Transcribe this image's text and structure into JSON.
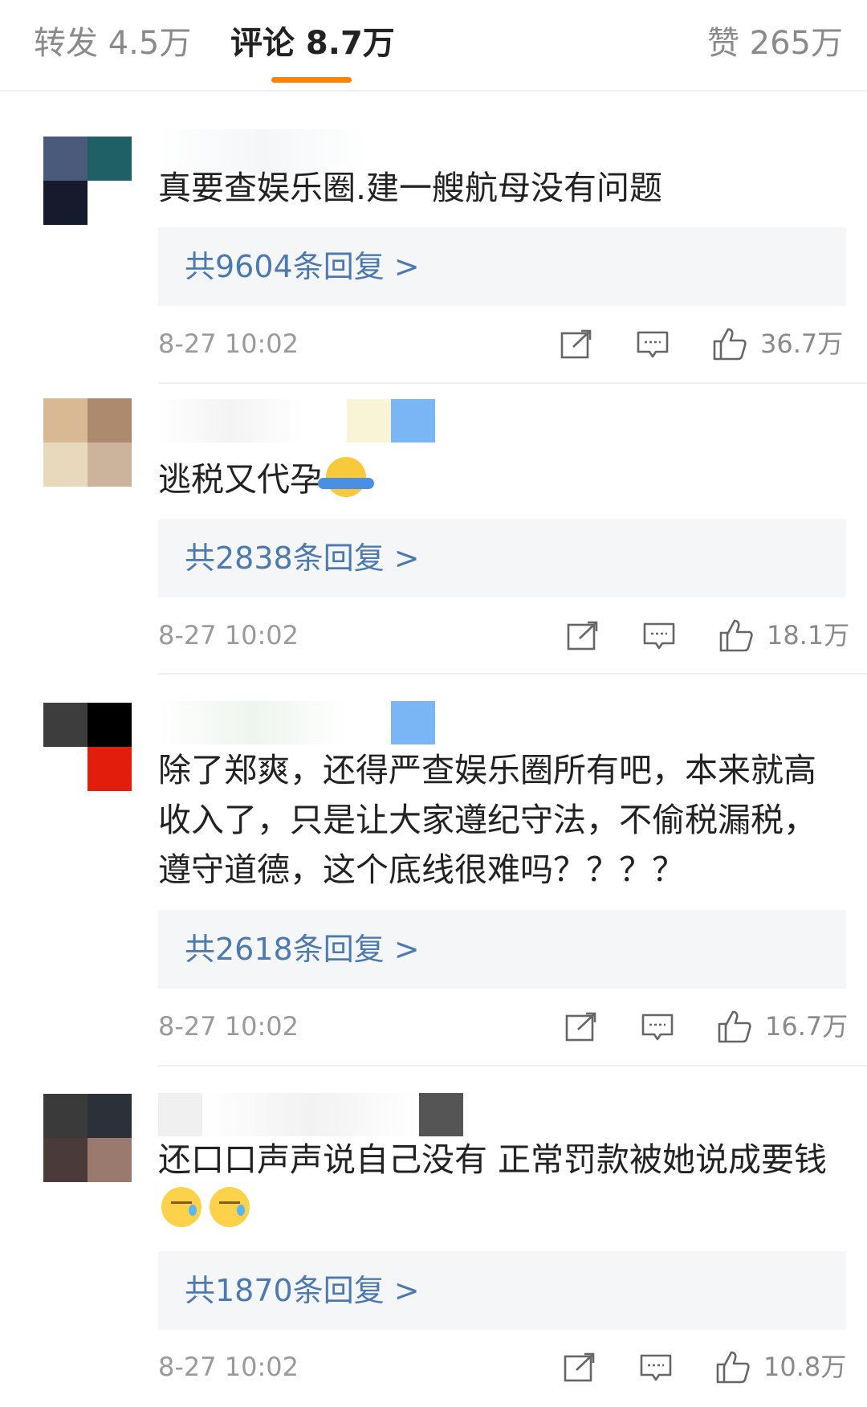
{
  "tabs": {
    "repost": "转发 4.5万",
    "comments": "评论 8.7万",
    "likes": "赞 265万"
  },
  "accent_color": "#ff8200",
  "link_color": "#4c7ab0",
  "comments": [
    {
      "text": "真要查娱乐圈.建一艘航母没有问题",
      "emojis": [],
      "replies": "共9604条回复 >",
      "timestamp": "8-27 10:02",
      "likes": "36.7万"
    },
    {
      "text": "逃税又代孕",
      "emojis": [
        "shrug-emoji"
      ],
      "replies": "共2838条回复 >",
      "timestamp": "8-27 10:02",
      "likes": "18.1万"
    },
    {
      "text": "除了郑爽，还得严查娱乐圈所有吧，本来就高收入了，只是让大家遵纪守法，不偷税漏税，遵守道德，这个底线很难吗？？？？",
      "emojis": [],
      "replies": "共2618条回复 >",
      "timestamp": "8-27 10:02",
      "likes": "16.7万"
    },
    {
      "text": "还口口声声说自己没有 正常罚款被她说成要钱",
      "emojis": [
        "sweat-emoji",
        "sweat-emoji"
      ],
      "replies": "共1870条回复 >",
      "timestamp": "8-27 10:02",
      "likes": "10.8万"
    }
  ],
  "icons": {
    "share": "share-icon",
    "comment": "comment-icon",
    "like": "thumbs-up-icon"
  }
}
